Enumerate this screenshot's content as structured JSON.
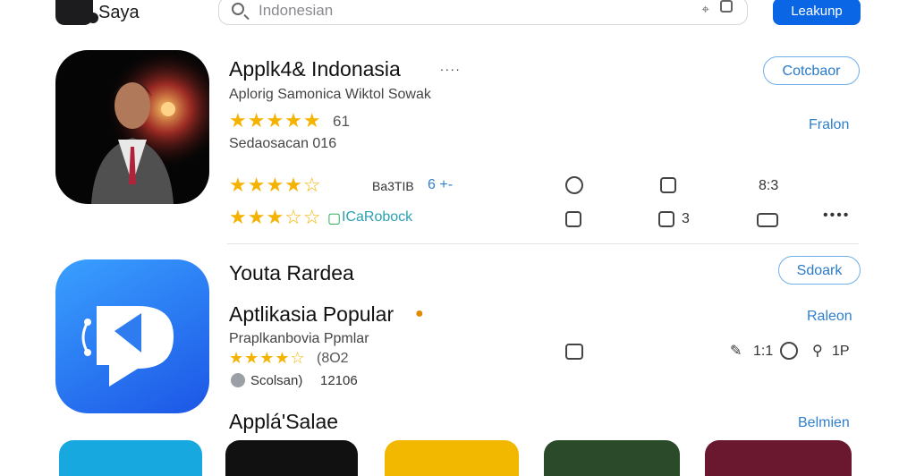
{
  "header": {
    "app_name": "Saya",
    "search_placeholder": "Indonesian",
    "primary_button": "Leakunp"
  },
  "card1": {
    "title": "Applk4& Indonasia",
    "more": "....",
    "subtitle": "Aplorig Samonica Wiktol Sowak",
    "rating_stars": "★★★★★",
    "rating_value": "61",
    "category": "Sedaosacan 016",
    "row_stars": "★★★★☆",
    "row_meta": "Ba3TIB",
    "row_blue": "6 +-",
    "row_value": "8:3",
    "row2_stars": "★★★☆☆",
    "row2_label": "ICaRobock",
    "row2_count": "3",
    "more_dots": "••••",
    "button": "Cotcbaor",
    "side_link": "Fralon"
  },
  "section1": {
    "title": "Youta Rardea",
    "button": "Sdoark"
  },
  "card2": {
    "title": "Aptlikasia Popular",
    "subtitle": "Praplkanbovia Ppmlar",
    "rating_stars": "★★★★☆",
    "rating_value": "(8O2",
    "reviews_label": "Scolsan)",
    "reviews_value": "12106",
    "side_link": "Raleon",
    "stat1": "1:1",
    "stat2": "1P"
  },
  "section2": {
    "title": "Applá'Salae",
    "link": "Belmien"
  }
}
